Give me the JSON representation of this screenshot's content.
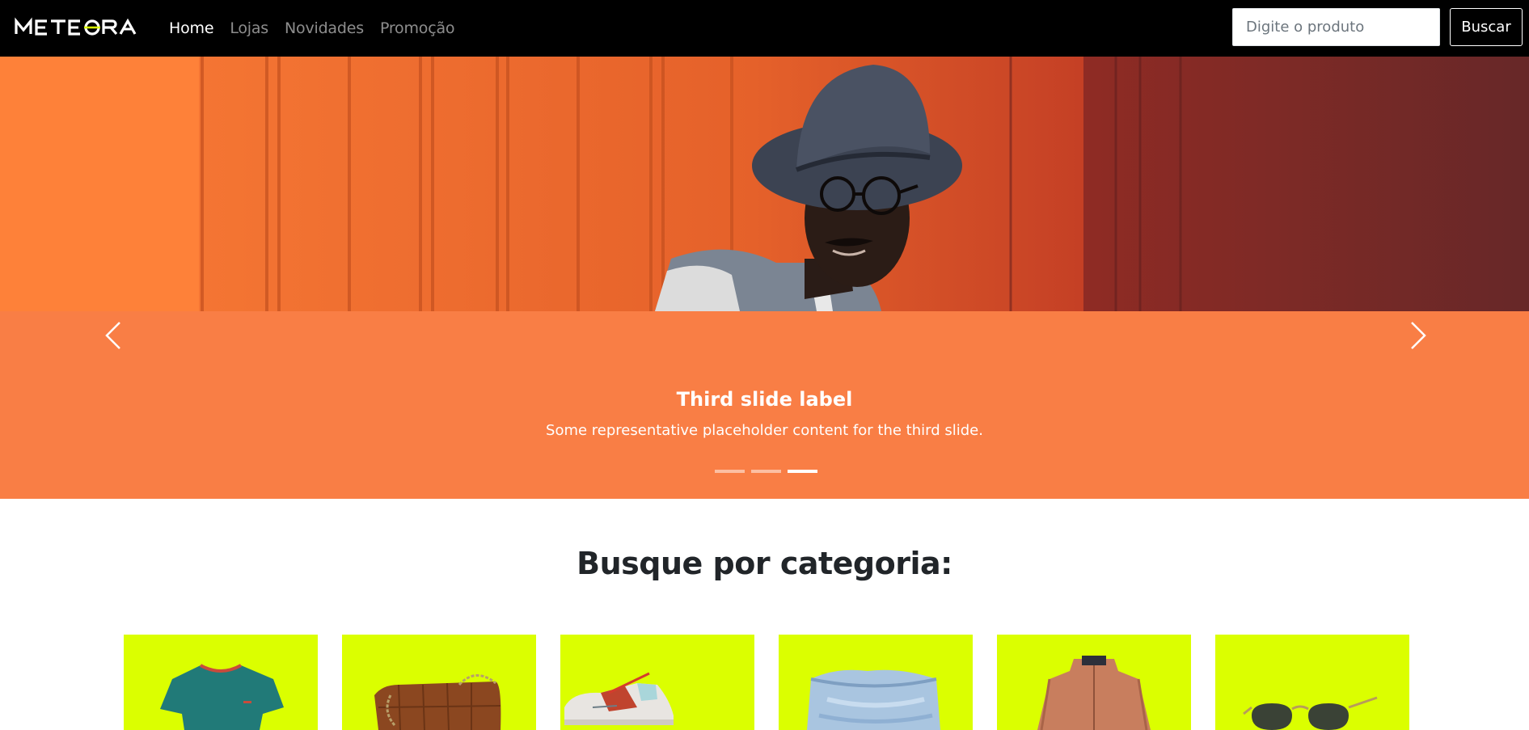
{
  "navbar": {
    "brand": "METEORA",
    "links": [
      {
        "label": "Home",
        "active": true
      },
      {
        "label": "Lojas",
        "active": false
      },
      {
        "label": "Novidades",
        "active": false
      },
      {
        "label": "Promoção",
        "active": false
      }
    ],
    "search": {
      "placeholder": "Digite o produto",
      "value": ""
    },
    "search_button_label": "Buscar"
  },
  "carousel": {
    "caption_title": "Third slide label",
    "caption_text": "Some representative placeholder content for the third slide.",
    "slide_count": 3,
    "active_slide": 3,
    "prev_icon": "chevron-left-icon",
    "next_icon": "chevron-right-icon"
  },
  "categories": {
    "title": "Busque por categoria:",
    "items": [
      {
        "icon": "tshirt-icon"
      },
      {
        "icon": "handbag-icon"
      },
      {
        "icon": "sneaker-icon"
      },
      {
        "icon": "jeans-icon"
      },
      {
        "icon": "jacket-icon"
      },
      {
        "icon": "sunglasses-icon"
      }
    ]
  },
  "colors": {
    "navbar_bg": "#000000",
    "carousel_bg": "#f97e45",
    "category_bg": "#dbff00",
    "accent_logo": "#dbff00"
  }
}
